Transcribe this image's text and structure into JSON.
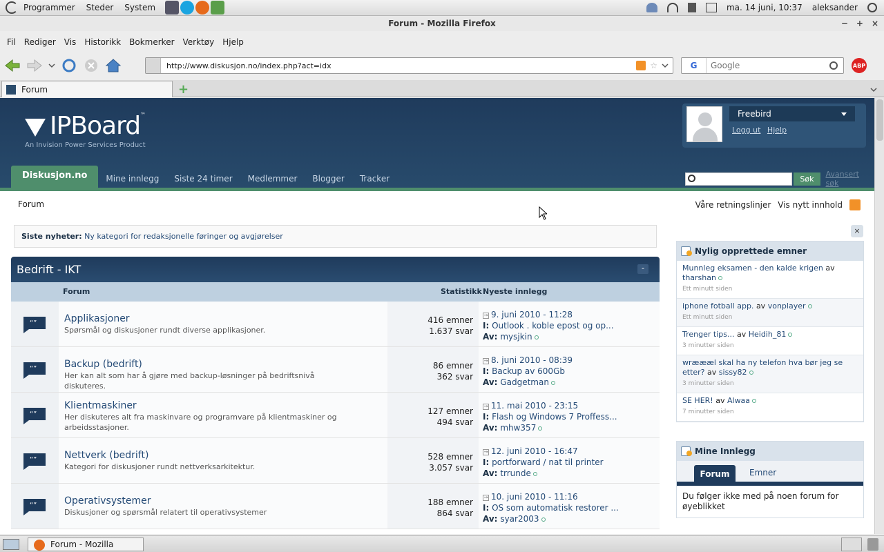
{
  "system_panel": {
    "menus": [
      "Programmer",
      "Steder",
      "System"
    ],
    "datetime": "ma. 14 juni, 10:37",
    "user": "aleksander"
  },
  "window": {
    "title": "Forum - Mozilla Firefox"
  },
  "browser_menu": [
    "Fil",
    "Rediger",
    "Vis",
    "Historikk",
    "Bokmerker",
    "Verktøy",
    "Hjelp"
  ],
  "browser": {
    "url": "http://www.diskusjon.no/index.php?act=idx",
    "search_placeholder": "Google",
    "tab_title": "Forum",
    "abp_label": "ABP"
  },
  "site": {
    "logo_word": "IPBoard",
    "logo_tm": "™",
    "logo_sub": "An Invision Power Services Product",
    "username": "Freebird",
    "logout": "Logg ut",
    "help": "Hjelp",
    "nav_active": "Diskusjon.no",
    "nav_items": [
      "Mine innlegg",
      "Siste 24 timer",
      "Medlemmer",
      "Blogger",
      "Tracker"
    ],
    "search_button": "Søk",
    "advanced_search": "Avansert søk",
    "breadcrumb": "Forum",
    "guidelines": "Våre retningslinjer",
    "new_content": "Vis nytt innhold",
    "news_label": "Siste nyheter:",
    "news_text": "Ny kategori for redaksjonelle føringer og avgjørelser"
  },
  "category": {
    "title": "Bedrift - IKT",
    "toggle": "-",
    "col_forum": "Forum",
    "col_stats": "Statistikk",
    "col_latest": "Nyeste innlegg",
    "label_in": "I:",
    "label_by": "Av:",
    "forums": [
      {
        "name": "Applikasjoner",
        "desc": "Spørsmål og diskusjoner rundt diverse applikasjoner.",
        "topics": "416 emner",
        "replies": "1.637 svar",
        "date": "9. juni 2010 - 11:28",
        "thread": "Outlook . koble epost og op...",
        "author": "mysjkin"
      },
      {
        "name": "Backup (bedrift)",
        "desc": "Her kan alt som har å gjøre med backup-løsninger på bedriftsnivå diskuteres.",
        "topics": "86 emner",
        "replies": "362 svar",
        "date": "8. juni 2010 - 08:39",
        "thread": "Backup av 600Gb",
        "author": "Gadgetman"
      },
      {
        "name": "Klientmaskiner",
        "desc": "Her diskuteres alt fra maskinvare og programvare på klientmaskiner og arbeidsstasjoner.",
        "topics": "127 emner",
        "replies": "494 svar",
        "date": "11. mai 2010 - 23:15",
        "thread": "Flash og Windows 7 Proffess...",
        "author": "mhw357"
      },
      {
        "name": "Nettverk (bedrift)",
        "desc": "Kategori for diskusjoner rundt nettverksarkitektur.",
        "topics": "528 emner",
        "replies": "3.057 svar",
        "date": "12. juni 2010 - 16:47",
        "thread": "portforward / nat til printer",
        "author": "trrunde"
      },
      {
        "name": "Operativsystemer",
        "desc": "Diskusjoner og spørsmål relatert til operativsystemer",
        "topics": "188 emner",
        "replies": "864 svar",
        "date": "10. juni 2010 - 11:16",
        "thread": "OS som automatisk restorer ...",
        "author": "syar2003"
      }
    ]
  },
  "sidebar": {
    "close": "×",
    "recent_title": "Nylig opprettede emner",
    "av": "av",
    "recent": [
      {
        "title": "Munnleg eksamen - den kalde krigen",
        "author": "tharshan",
        "time": "Ett minutt siden"
      },
      {
        "title": "iphone fotball app.",
        "author": "vonplayer",
        "time": "Ett minutt siden"
      },
      {
        "title": "Trenger tips...",
        "author": "Heidih_81",
        "time": "3 minutter siden"
      },
      {
        "title": "wræææl skal ha ny telefon hva bør jeg se etter?",
        "author": "sissy82",
        "time": "3 minutter siden"
      },
      {
        "title": "SE HER!",
        "author": "Alwaa",
        "time": "7 minutter siden"
      }
    ],
    "my_title": "Mine Innlegg",
    "my_tab_active": "Forum",
    "my_tab_other": "Emner",
    "my_text": "Du følger ikke med på noen forum for øyeblikket"
  },
  "taskbar": {
    "task": "Forum - Mozilla Firefox"
  }
}
